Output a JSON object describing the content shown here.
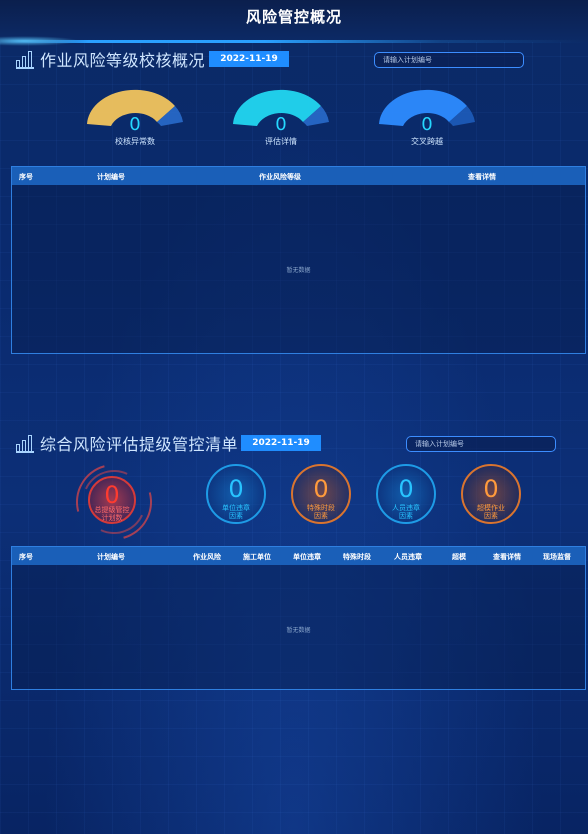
{
  "page": {
    "title": "风险管控概况"
  },
  "section1": {
    "title": "作业风险等级校核概况",
    "date": "2022-11-19",
    "search_placeholder": "请输入计划编号",
    "gauges": [
      {
        "value": "0",
        "label": "校核异常数",
        "color": "#f2c45d"
      },
      {
        "value": "0",
        "label": "评估详情",
        "color": "#22d6f0"
      },
      {
        "value": "0",
        "label": "交叉跨越",
        "color": "#2d8bff"
      }
    ],
    "table": {
      "columns": [
        "序号",
        "计划编号",
        "作业风险等级",
        "查看详情"
      ],
      "empty_text": "暂无数据"
    }
  },
  "section2": {
    "title": "综合风险评估提级管控清单",
    "date": "2022-11-19",
    "search_placeholder": "请输入计划编号",
    "circles": [
      {
        "value": "0",
        "label_line1": "总提级管控",
        "label_line2": "计划数",
        "color": "#ff3b2f"
      },
      {
        "value": "0",
        "label_line1": "单位违章",
        "label_line2": "因素",
        "color": "#28c4ff"
      },
      {
        "value": "0",
        "label_line1": "特殊时段",
        "label_line2": "因素",
        "color": "#ff9a3c"
      },
      {
        "value": "0",
        "label_line1": "人员违章",
        "label_line2": "因素",
        "color": "#28c4ff"
      },
      {
        "value": "0",
        "label_line1": "超模作业",
        "label_line2": "因素",
        "color": "#ff9a3c"
      }
    ],
    "table": {
      "columns": [
        "序号",
        "计划编号",
        "作业风险",
        "施工单位",
        "单位违章",
        "特殊时段",
        "人员违章",
        "超模",
        "查看详情",
        "现场监督"
      ],
      "empty_text": "暂无数据"
    }
  }
}
